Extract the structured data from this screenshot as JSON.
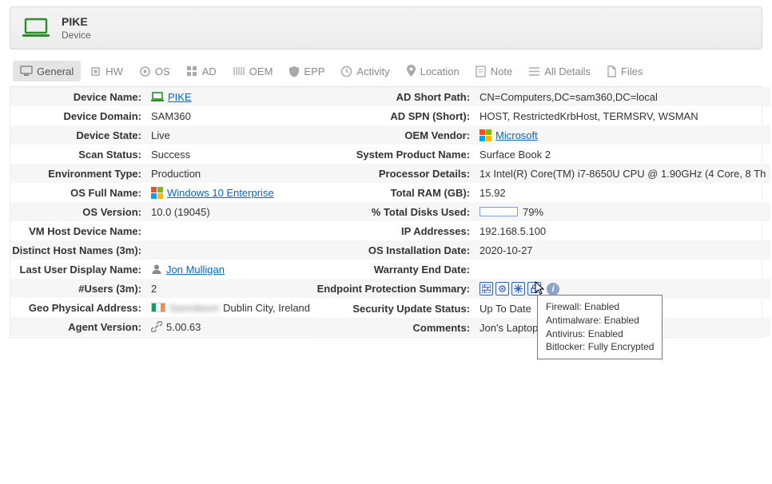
{
  "header": {
    "title": "PIKE",
    "subtitle": "Device"
  },
  "tabs": [
    {
      "id": "general",
      "label": "General"
    },
    {
      "id": "hw",
      "label": "HW"
    },
    {
      "id": "os",
      "label": "OS"
    },
    {
      "id": "ad",
      "label": "AD"
    },
    {
      "id": "oem",
      "label": "OEM"
    },
    {
      "id": "epp",
      "label": "EPP"
    },
    {
      "id": "activity",
      "label": "Activity"
    },
    {
      "id": "location",
      "label": "Location"
    },
    {
      "id": "note",
      "label": "Note"
    },
    {
      "id": "alldetails",
      "label": "All Details"
    },
    {
      "id": "files",
      "label": "Files"
    }
  ],
  "left": {
    "device_name_label": "Device Name:",
    "device_name_value": "PIKE",
    "device_domain_label": "Device Domain:",
    "device_domain_value": "SAM360",
    "device_state_label": "Device State:",
    "device_state_value": "Live",
    "scan_status_label": "Scan Status:",
    "scan_status_value": "Success",
    "env_type_label": "Environment Type:",
    "env_type_value": "Production",
    "os_full_label": "OS Full Name:",
    "os_full_value": "Windows 10 Enterprise",
    "os_version_label": "OS Version:",
    "os_version_value": "10.0 (19045)",
    "vm_host_label": "VM Host Device Name:",
    "vm_host_value": "",
    "distinct_host_label": "Distinct Host Names (3m):",
    "distinct_host_value": "",
    "last_user_label": "Last User Display Name:",
    "last_user_value": "Jon Mulligan",
    "users_3m_label": "#Users (3m):",
    "users_3m_value": "2",
    "geo_addr_label": "Geo Physical Address:",
    "geo_addr_blur": "Samobson",
    "geo_addr_value": "Dublin City, Ireland",
    "agent_version_label": "Agent Version:",
    "agent_version_value": "5.00.63"
  },
  "right": {
    "ad_short_path_label": "AD Short Path:",
    "ad_short_path_value": "CN=Computers,DC=sam360,DC=local",
    "ad_spn_label": "AD SPN (Short):",
    "ad_spn_value": "HOST, RestrictedKrbHost, TERMSRV, WSMAN",
    "oem_vendor_label": "OEM Vendor:",
    "oem_vendor_value": "Microsoft",
    "sys_product_label": "System Product Name:",
    "sys_product_value": "Surface Book 2",
    "processor_label": "Processor Details:",
    "processor_value": "1x Intel(R) Core(TM) i7-8650U CPU @ 1.90GHz (4 Core, 8 Th",
    "total_ram_label": "Total RAM (GB):",
    "total_ram_value": "15.92",
    "disks_used_label": "% Total Disks Used:",
    "disks_used_pct": "79%",
    "disks_used_fill": 79,
    "ip_addresses_label": "IP Addresses:",
    "ip_addresses_value": "192.168.5.100",
    "os_install_date_label": "OS Installation Date:",
    "os_install_date_value": "2020-10-27",
    "warranty_end_label": "Warranty End Date:",
    "warranty_end_value": "",
    "epp_summary_label": "Endpoint Protection Summary:",
    "sec_update_label": "Security Update Status:",
    "sec_update_value": "Up To Date",
    "comments_label": "Comments:",
    "comments_value": "Jon's Laptop"
  },
  "tooltip": {
    "line1": "Firewall: Enabled",
    "line2": "Antimalware: Enabled",
    "line3": "Antivirus: Enabled",
    "line4": "Bitlocker: Fully Encrypted"
  }
}
